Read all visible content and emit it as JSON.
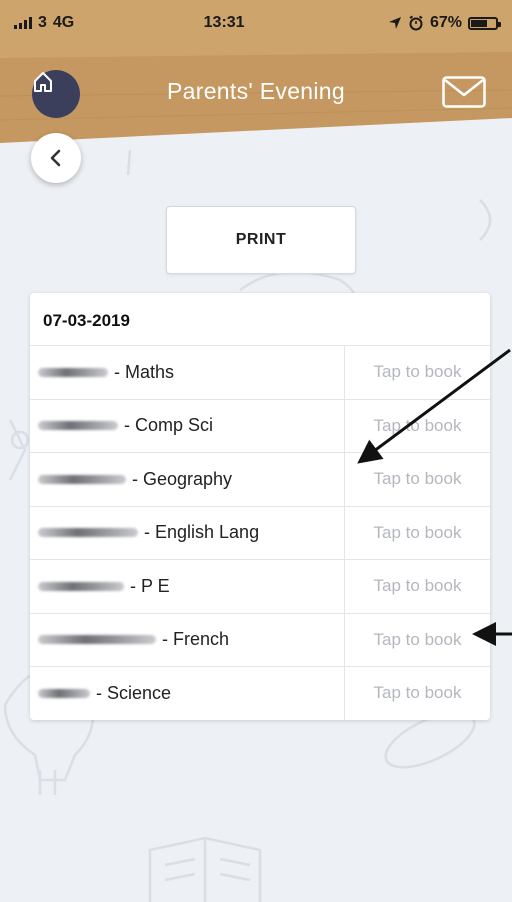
{
  "status_bar": {
    "carrier": "3",
    "network": "4G",
    "time": "13:31",
    "battery_text": "67%",
    "battery_level": 0.67
  },
  "header": {
    "title": "Parents' Evening",
    "bg_color": "#c59861"
  },
  "print_label": "PRINT",
  "date": "07-03-2019",
  "appointments": [
    {
      "subject": "- Maths",
      "action": "Tap to book"
    },
    {
      "subject": "- Comp Sci",
      "action": "Tap to book"
    },
    {
      "subject": "- Geography",
      "action": "Tap to book"
    },
    {
      "subject": "- English Lang",
      "action": "Tap to book"
    },
    {
      "subject": "- P E",
      "action": "Tap to book"
    },
    {
      "subject": "- French",
      "action": "Tap to book"
    },
    {
      "subject": "- Science",
      "action": "Tap to book"
    }
  ],
  "icons": [
    "home-icon",
    "mail-icon",
    "back-chevron-icon"
  ]
}
